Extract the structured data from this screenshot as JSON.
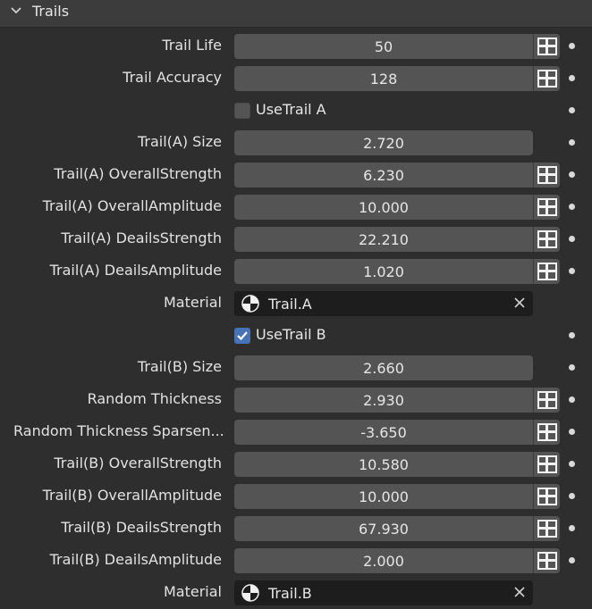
{
  "panel": {
    "title": "Trails"
  },
  "rows": [
    {
      "label": "Trail Life",
      "value": "50"
    },
    {
      "label": "Trail Accuracy",
      "value": "128"
    },
    {
      "checkbox_label": "UseTrail A",
      "checked": false
    },
    {
      "label": "Trail(A) Size",
      "value": "2.720"
    },
    {
      "label": "Trail(A) OverallStrength",
      "value": "6.230"
    },
    {
      "label": "Trail(A) OverallAmplitude",
      "value": "10.000"
    },
    {
      "label": "Trail(A) DeailsStrength",
      "value": "22.210"
    },
    {
      "label": "Trail(A) DeailsAmplitude",
      "value": "1.020"
    },
    {
      "label": "Material",
      "material": "Trail.A"
    },
    {
      "checkbox_label": "UseTrail B",
      "checked": true
    },
    {
      "label": "Trail(B) Size",
      "value": "2.660"
    },
    {
      "label": "Random Thickness",
      "value": "2.930"
    },
    {
      "label": "Random Thickness Sparsen...",
      "value": "-3.650"
    },
    {
      "label": "Trail(B) OverallStrength",
      "value": "10.580"
    },
    {
      "label": "Trail(B) OverallAmplitude",
      "value": "10.000"
    },
    {
      "label": "Trail(B) DeailsStrength",
      "value": "67.930"
    },
    {
      "label": "Trail(B) DeailsAmplitude",
      "value": "2.000"
    },
    {
      "label": "Material",
      "material": "Trail.B"
    }
  ]
}
